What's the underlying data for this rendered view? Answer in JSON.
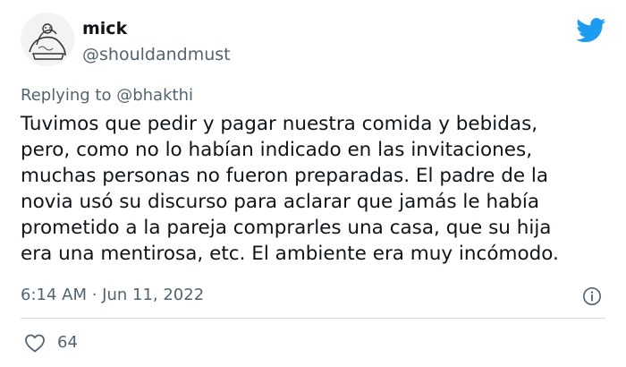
{
  "author": {
    "display_name": "mick",
    "handle": "@shouldandmust"
  },
  "reply": {
    "prefix": "Replying to",
    "user": "@bhakthi"
  },
  "text_lines": [
    "Tuvimos que pedir y pagar nuestra comida y bebidas,",
    "pero, como no lo habían indicado en las invitaciones,",
    "muchas personas no fueron preparadas. El padre de la",
    "novia usó su discurso para aclarar que jamás le había",
    "prometido a la pareja comprarles una casa, que su hija",
    "era una mentirosa, etc. El ambiente era muy incómodo."
  ],
  "timestamp": "6:14 AM · Jun 11, 2022",
  "likes": "64",
  "icons": {
    "brand": "twitter-bird-icon",
    "info": "info-icon",
    "like": "heart-icon"
  },
  "colors": {
    "brand": "#1d9bf0",
    "text": "#0f1419",
    "muted": "#536471",
    "divider": "#cfd9de"
  }
}
